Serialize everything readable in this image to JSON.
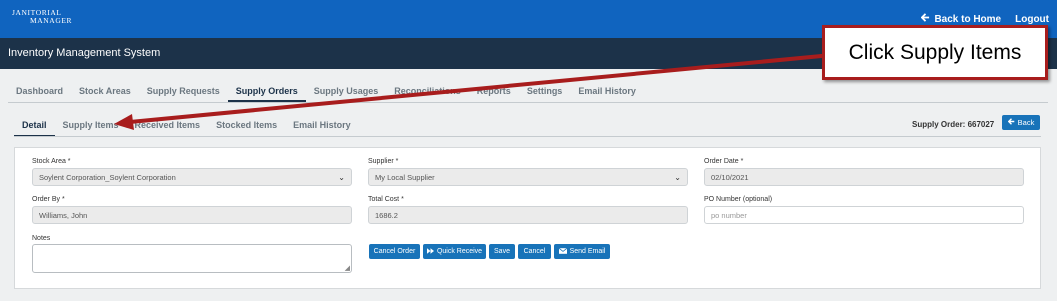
{
  "header": {
    "logo_line1": "Janitorial",
    "logo_line2": "Manager",
    "back_home": "Back to Home",
    "logout": "Logout"
  },
  "app_title": "Inventory Management System",
  "main_tabs": [
    "Dashboard",
    "Stock Areas",
    "Supply Requests",
    "Supply Orders",
    "Supply Usages",
    "Reconciliations",
    "Reports",
    "Settings",
    "Email History"
  ],
  "main_active": "Supply Orders",
  "sub_tabs": [
    "Detail",
    "Supply Items",
    "Received Items",
    "Stocked Items",
    "Email History"
  ],
  "sub_active": "Detail",
  "order_label": "Supply Order: 667027",
  "back_button": "Back",
  "form": {
    "stock_area_label": "Stock Area *",
    "stock_area_value": "Soylent Corporation_Soylent Corporation",
    "supplier_label": "Supplier *",
    "supplier_value": "My Local Supplier",
    "order_date_label": "Order Date *",
    "order_date_value": "02/10/2021",
    "order_by_label": "Order By *",
    "order_by_value": "Williams, John",
    "total_cost_label": "Total Cost *",
    "total_cost_value": "1686.2",
    "po_label": "PO Number (optional)",
    "po_placeholder": "po number",
    "notes_label": "Notes"
  },
  "actions": {
    "cancel_order": "Cancel Order",
    "quick_receive": "Quick Receive",
    "save": "Save",
    "cancel": "Cancel",
    "send_email": "Send Email"
  },
  "annotation": {
    "callout_text": "Click Supply Items",
    "color": "#a81d1d"
  },
  "colors": {
    "topbar": "#1064bf",
    "titlebar": "#1c3249",
    "button": "#1873b9"
  }
}
